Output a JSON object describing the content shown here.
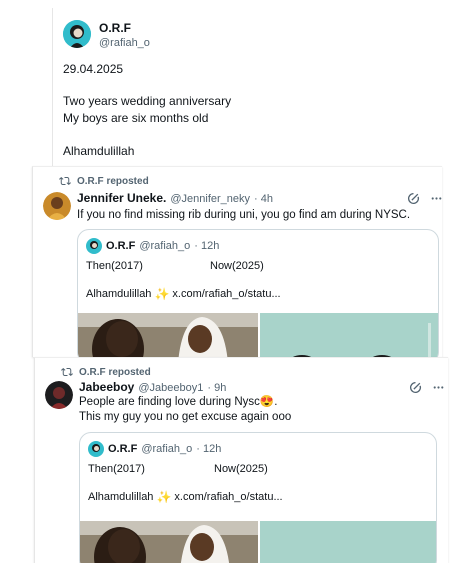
{
  "main_post": {
    "name": "O.R.F",
    "handle": "@rafiah_o",
    "lines": [
      "29.04.2025",
      "Two years wedding anniversary",
      "My boys are six months old",
      "Alhamdulillah"
    ]
  },
  "repost1": {
    "repost_label": "O.R.F reposted",
    "name": "Jennifer Uneke.",
    "handle": "@Jennifer_neky",
    "time": "· 4h",
    "text": "If you no find missing rib during uni, you go find am during NYSC.",
    "quote": {
      "name": "O.R.F",
      "handle": "@rafiah_o",
      "time": "· 12h",
      "then": "Then(2017)",
      "now": "Now(2025)",
      "alham": "Alhamdulillah",
      "link": "x.com/rafiah_o/statu..."
    }
  },
  "repost2": {
    "repost_label": "O.R.F reposted",
    "name": "Jabeeboy",
    "handle": "@Jabeeboy1",
    "time": "· 9h",
    "text1": "People are finding love during Nysc",
    "emoji": "😍",
    "text1_end": ".",
    "text2": "This my guy you no get excuse again ooo",
    "quote": {
      "name": "O.R.F",
      "handle": "@rafiah_o",
      "time": "· 12h",
      "then": "Then(2017)",
      "now": "Now(2025)",
      "alham": "Alhamdulillah",
      "link": "x.com/rafiah_o/statu..."
    }
  },
  "icons": {
    "repost": "repost-icon",
    "grok": "grok-icon",
    "more": "more-icon",
    "sparkle": "sparkle-icon"
  },
  "colors": {
    "text": "#0f1419",
    "muted": "#536471",
    "border": "#cfd9de",
    "sparkle": "#f7b500"
  }
}
